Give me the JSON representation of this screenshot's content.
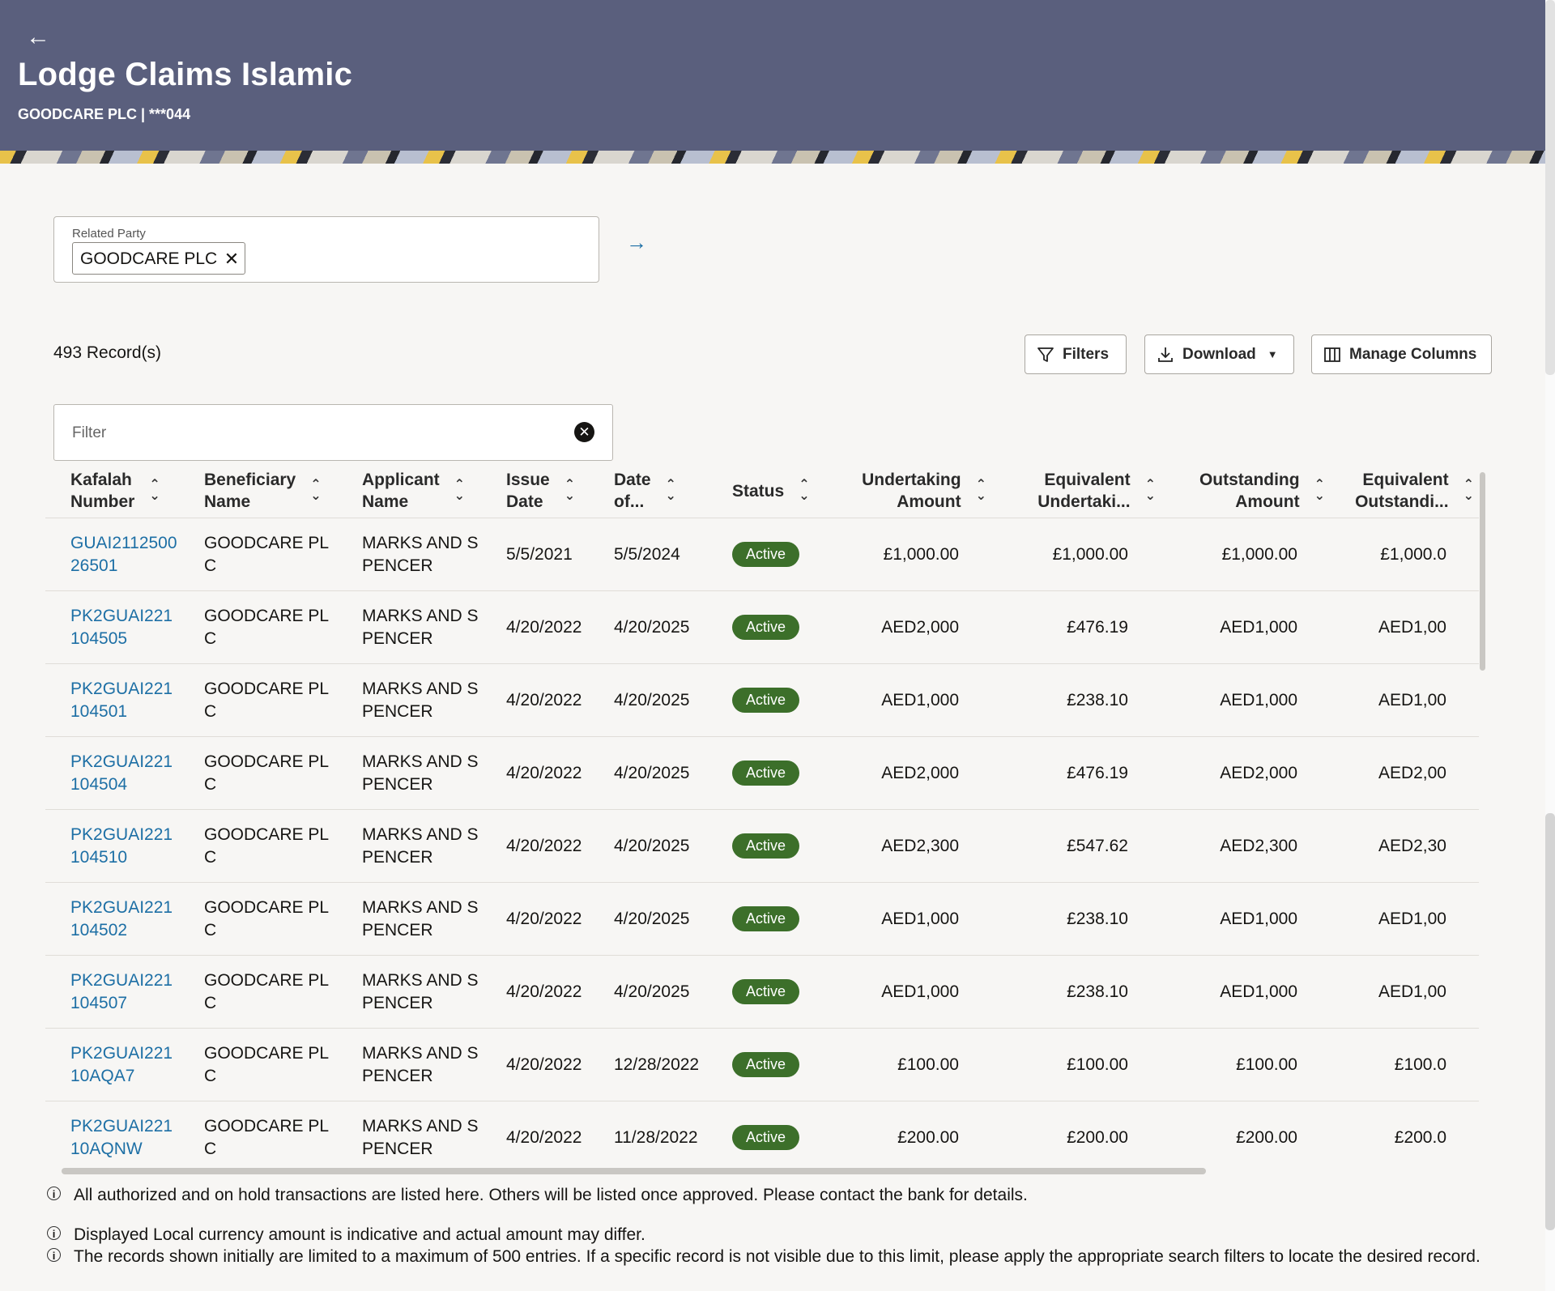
{
  "header": {
    "title": "Lodge Claims Islamic",
    "subtitle": "GOODCARE PLC | ***044"
  },
  "related_party": {
    "label": "Related Party",
    "chip": "GOODCARE PLC"
  },
  "records_label": "493 Record(s)",
  "toolbar": {
    "filters": "Filters",
    "download": "Download",
    "manage_columns": "Manage Columns"
  },
  "filter": {
    "placeholder": "Filter"
  },
  "table": {
    "columns": [
      {
        "line1": "Kafalah",
        "line2": "Number"
      },
      {
        "line1": "Beneficiary",
        "line2": "Name"
      },
      {
        "line1": "Applicant",
        "line2": "Name"
      },
      {
        "line1": "Issue",
        "line2": "Date"
      },
      {
        "line1": "Date",
        "line2": "of..."
      },
      {
        "line1": "Status",
        "line2": ""
      },
      {
        "line1": "Undertaking",
        "line2": "Amount"
      },
      {
        "line1": "Equivalent",
        "line2": "Undertaki..."
      },
      {
        "line1": "Outstanding",
        "line2": "Amount"
      },
      {
        "line1": "Equivalent",
        "line2": "Outstandi..."
      }
    ],
    "rows": [
      {
        "kafalah": "GUAI211250026501",
        "beneficiary": "GOODCARE PLC",
        "applicant": "MARKS AND SPENCER",
        "issue": "5/5/2021",
        "date_of": "5/5/2024",
        "status": "Active",
        "und_amt": "£1,000.00",
        "eq_und": "£1,000.00",
        "out_amt": "£1,000.00",
        "eq_out": "£1,000.0"
      },
      {
        "kafalah": "PK2GUAI221104505",
        "beneficiary": "GOODCARE PLC",
        "applicant": "MARKS AND SPENCER",
        "issue": "4/20/2022",
        "date_of": "4/20/2025",
        "status": "Active",
        "und_amt": "AED2,000",
        "eq_und": "£476.19",
        "out_amt": "AED1,000",
        "eq_out": "AED1,00"
      },
      {
        "kafalah": "PK2GUAI221104501",
        "beneficiary": "GOODCARE PLC",
        "applicant": "MARKS AND SPENCER",
        "issue": "4/20/2022",
        "date_of": "4/20/2025",
        "status": "Active",
        "und_amt": "AED1,000",
        "eq_und": "£238.10",
        "out_amt": "AED1,000",
        "eq_out": "AED1,00"
      },
      {
        "kafalah": "PK2GUAI221104504",
        "beneficiary": "GOODCARE PLC",
        "applicant": "MARKS AND SPENCER",
        "issue": "4/20/2022",
        "date_of": "4/20/2025",
        "status": "Active",
        "und_amt": "AED2,000",
        "eq_und": "£476.19",
        "out_amt": "AED2,000",
        "eq_out": "AED2,00"
      },
      {
        "kafalah": "PK2GUAI221104510",
        "beneficiary": "GOODCARE PLC",
        "applicant": "MARKS AND SPENCER",
        "issue": "4/20/2022",
        "date_of": "4/20/2025",
        "status": "Active",
        "und_amt": "AED2,300",
        "eq_und": "£547.62",
        "out_amt": "AED2,300",
        "eq_out": "AED2,30"
      },
      {
        "kafalah": "PK2GUAI221104502",
        "beneficiary": "GOODCARE PLC",
        "applicant": "MARKS AND SPENCER",
        "issue": "4/20/2022",
        "date_of": "4/20/2025",
        "status": "Active",
        "und_amt": "AED1,000",
        "eq_und": "£238.10",
        "out_amt": "AED1,000",
        "eq_out": "AED1,00"
      },
      {
        "kafalah": "PK2GUAI221104507",
        "beneficiary": "GOODCARE PLC",
        "applicant": "MARKS AND SPENCER",
        "issue": "4/20/2022",
        "date_of": "4/20/2025",
        "status": "Active",
        "und_amt": "AED1,000",
        "eq_und": "£238.10",
        "out_amt": "AED1,000",
        "eq_out": "AED1,00"
      },
      {
        "kafalah": "PK2GUAI22110AQA7",
        "beneficiary": "GOODCARE PLC",
        "applicant": "MARKS AND SPENCER",
        "issue": "4/20/2022",
        "date_of": "12/28/2022",
        "status": "Active",
        "und_amt": "£100.00",
        "eq_und": "£100.00",
        "out_amt": "£100.00",
        "eq_out": "£100.0"
      },
      {
        "kafalah": "PK2GUAI22110AQNW",
        "beneficiary": "GOODCARE PLC",
        "applicant": "MARKS AND SPENCER",
        "issue": "4/20/2022",
        "date_of": "11/28/2022",
        "status": "Active",
        "und_amt": "£200.00",
        "eq_und": "£200.00",
        "out_amt": "£200.00",
        "eq_out": "£200.0"
      }
    ]
  },
  "notes": [
    "All authorized and on hold transactions are listed here. Others will be listed once approved. Please contact the bank for details.",
    "Displayed Local currency amount is indicative and actual amount may differ.",
    "The records shown initially are limited to a maximum of 500 entries. If a specific record is not visible due to this limit, please apply the appropriate search filters to locate the desired record."
  ],
  "colors": {
    "header_bg": "#5a5f7d",
    "link": "#1d6fa5",
    "status_active": "#3c6f2a"
  },
  "icons": [
    "back-arrow-icon",
    "close-icon",
    "arrow-right-icon",
    "filter-icon",
    "download-icon",
    "columns-icon",
    "clear-icon",
    "sort-icon",
    "info-icon"
  ]
}
